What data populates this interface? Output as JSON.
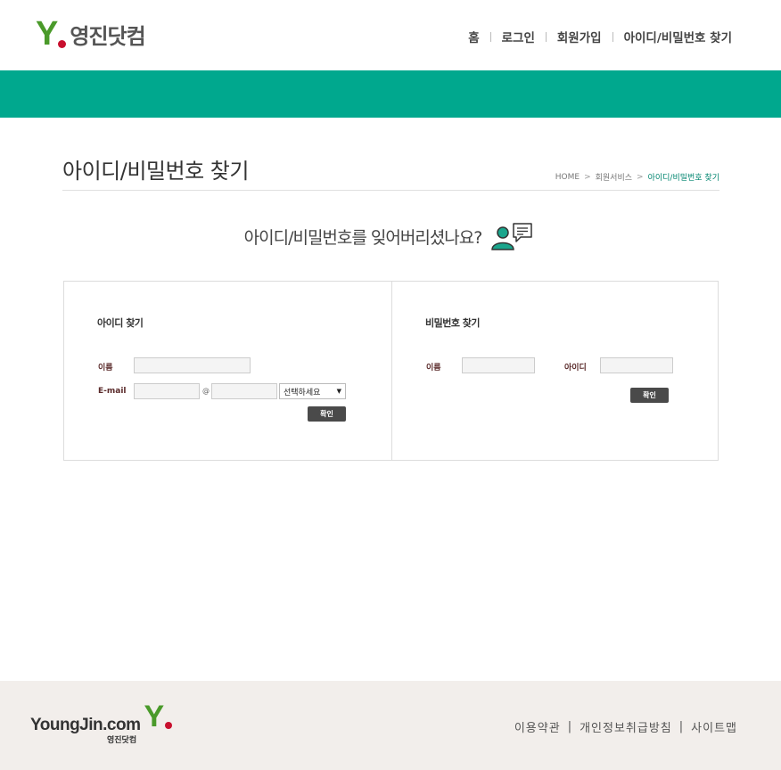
{
  "header": {
    "logo_letter": "Y",
    "logo_text": "영진닷컴",
    "nav": [
      "홈",
      "로그인",
      "회원가입",
      "아이디/비밀번호 찾기"
    ]
  },
  "colors": {
    "accent": "#00a88e",
    "logo_green": "#4a9a2a",
    "logo_red": "#c8102e",
    "footer_bg": "#f2eeeb"
  },
  "title": {
    "heading": "아이디/비밀번호 찾기",
    "breadcrumb": [
      "HOME",
      "회원서비스",
      "아이디/비밀번호 찾기"
    ]
  },
  "question": {
    "text": "아이디/비밀번호를 잊어버리셨나요?",
    "icon": "user-chat-icon"
  },
  "find_id": {
    "title": "아이디 찾기",
    "name_label": "이름",
    "name_value": "",
    "email_label": "E-mail",
    "email_user": "",
    "at": "@",
    "email_domain": "",
    "domain_select": "선택하세요",
    "submit": "확인"
  },
  "find_pw": {
    "title": "비밀번호 찾기",
    "name_label": "이름",
    "name_value": "",
    "id_label": "아이디",
    "id_value": "",
    "submit": "확인"
  },
  "footer": {
    "logo_text": "YoungJin.com",
    "logo_sub": "영진닷컴",
    "logo_letter": "Y",
    "links": [
      "이용약관",
      "개인정보취급방침",
      "사이트맵"
    ],
    "separator": "|"
  }
}
